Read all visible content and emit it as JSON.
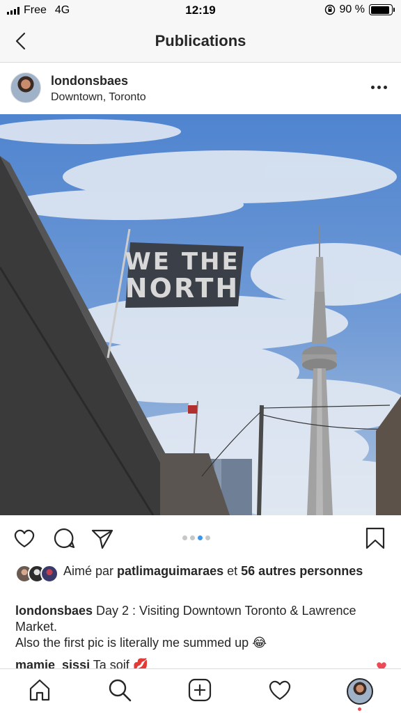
{
  "status_bar": {
    "carrier": "Free",
    "network": "4G",
    "time": "12:19",
    "battery_percent": "90 %",
    "battery_level": 0.9
  },
  "header": {
    "title": "Publications",
    "back_icon": "chevron-left-icon"
  },
  "post": {
    "username": "londonsbaes",
    "location": "Downtown, Toronto",
    "photo": {
      "flag_text_line1": "WE THE",
      "flag_text_line2": "NORTH"
    },
    "carousel": {
      "count": 4,
      "active_index": 2
    },
    "likes": {
      "prefix": "Aimé par",
      "user": "patlimaguimaraes",
      "conjunction": "et",
      "others": "56 autres personnes"
    },
    "caption": {
      "username": "londonsbaes",
      "text": "Day 2 : Visiting Downtown Toronto & Lawrence Market.",
      "line2": "Also the first pic is literally me summed up 😂"
    },
    "comment": {
      "username": "mamie_sissi",
      "text": "Ta soif 💋"
    }
  },
  "colors": {
    "accent": "#3897f0",
    "text": "#262626",
    "sky": "#5e8fd4",
    "notification": "#ed4956"
  },
  "tabbar": {
    "items": [
      "home-icon",
      "search-icon",
      "add-post-icon",
      "activity-heart-icon",
      "profile-avatar"
    ]
  }
}
